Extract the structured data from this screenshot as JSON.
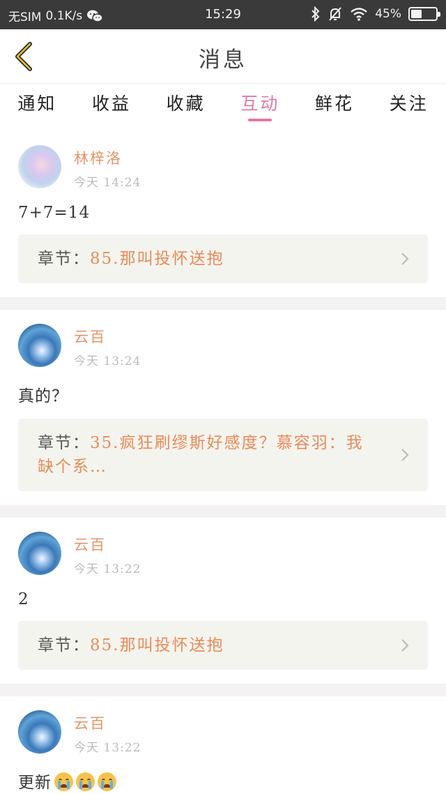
{
  "status_bar": {
    "carrier": "无SIM",
    "speed": "0.1K/s",
    "time": "15:29",
    "battery": "45%",
    "battery_level": 0.45
  },
  "header": {
    "title": "消息"
  },
  "tabs": [
    {
      "label": "通知",
      "active": false
    },
    {
      "label": "收益",
      "active": false
    },
    {
      "label": "收藏",
      "active": false
    },
    {
      "label": "互动",
      "active": true
    },
    {
      "label": "鲜花",
      "active": false
    },
    {
      "label": "关注",
      "active": false
    }
  ],
  "chapter_prefix": "章节：",
  "messages": [
    {
      "user": "林梓洛",
      "time": "今天 14:24",
      "content": "7+7=14",
      "chapter": "85.那叫投怀送抱",
      "avatar": "avatar-girl-icon"
    },
    {
      "user": "云百",
      "time": "今天 13:24",
      "content": "真的？",
      "chapter": "35.疯狂刷缪斯好感度？慕容羽：我缺个系…",
      "avatar": "avatar-blue-icon"
    },
    {
      "user": "云百",
      "time": "今天 13:22",
      "content": "2",
      "chapter": "85.那叫投怀送抱",
      "avatar": "avatar-blue-icon"
    },
    {
      "user": "云百",
      "time": "今天 13:22",
      "content": "更新",
      "emoji_count": 3,
      "emoji": "crying-face-emoji",
      "avatar": "avatar-blue-icon"
    }
  ],
  "colors": {
    "accent_pink": "#e07aa8",
    "username_orange": "#e89468",
    "chapter_orange": "#ea8a56",
    "statusbar_bg": "#3a3a3a"
  }
}
